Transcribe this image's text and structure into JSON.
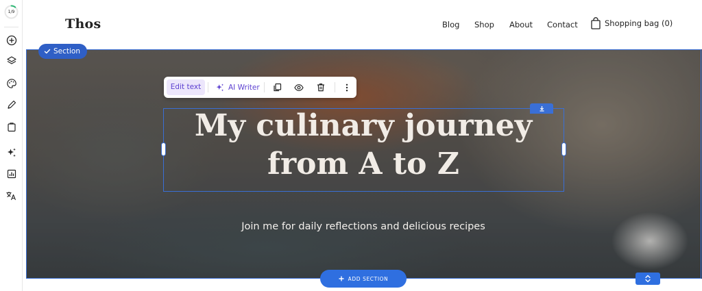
{
  "sidebar": {
    "progress_label": "1/9",
    "progress_fraction": 0.11,
    "tools": [
      {
        "name": "add-icon"
      },
      {
        "name": "layers-icon"
      },
      {
        "name": "palette-icon"
      },
      {
        "name": "pen-icon"
      },
      {
        "name": "clipboard-icon"
      },
      {
        "name": "ai-sparkle-icon"
      },
      {
        "name": "analytics-icon"
      },
      {
        "name": "translate-icon"
      }
    ]
  },
  "site": {
    "logo": "Thos",
    "nav": [
      "Blog",
      "Shop",
      "About",
      "Contact"
    ],
    "bag_label": "Shopping bag (0)"
  },
  "section": {
    "badge_label": "Section",
    "title": "My culinary journey from A to Z",
    "subtitle": "Join me for daily reflections and delicious recipes"
  },
  "toolbar": {
    "edit_text_label": "Edit text",
    "ai_writer_label": "AI Writer",
    "icons": [
      "duplicate-icon",
      "preview-icon",
      "delete-icon",
      "more-icon"
    ]
  },
  "footer_controls": {
    "add_section_label": "ADD SECTION"
  },
  "colors": {
    "accent": "#3a6fd6",
    "button_blue": "#2f6fe0",
    "ai_purple": "#5b3fd0",
    "progress_green": "#2bb673"
  }
}
